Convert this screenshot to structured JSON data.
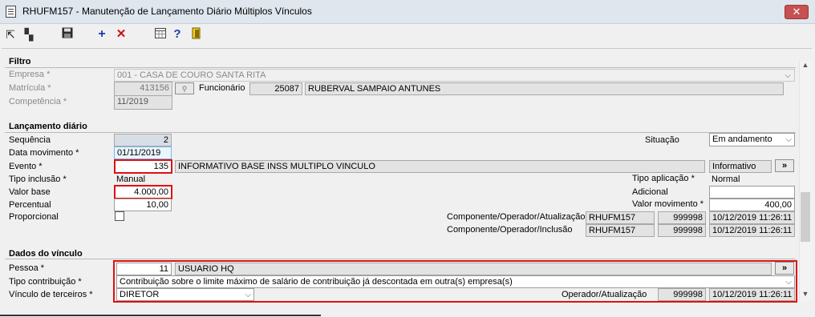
{
  "window": {
    "title": "RHUFM157 - Manutenção de Lançamento Diário Múltiplos Vínculos"
  },
  "filtro": {
    "title": "Filtro",
    "empresa_label": "Empresa *",
    "empresa_value": "001 - CASA DE COURO SANTA RITA",
    "matricula_label": "Matrícula *",
    "matricula_value": "413156",
    "funcionario_label": "Funcionário",
    "funcionario_code": "25087",
    "funcionario_name": "RUBERVAL SAMPAIO ANTUNES",
    "competencia_label": "Competência *",
    "competencia_value": "11/2019"
  },
  "lancamento": {
    "title": "Lançamento diário",
    "sequencia_label": "Sequência",
    "sequencia_value": "2",
    "situacao_label": "Situação",
    "situacao_value": "Em andamento",
    "data_label": "Data movimento *",
    "data_value": "01/11/2019",
    "evento_label": "Evento *",
    "evento_code": "135",
    "evento_desc": "INFORMATIVO BASE INSS MULTIPLO VINCULO",
    "evento_tipo": "Informativo",
    "evento_btn": "»",
    "tipo_inclusao_label": "Tipo inclusão *",
    "tipo_inclusao_value": "Manual",
    "tipo_aplicacao_label": "Tipo aplicação *",
    "tipo_aplicacao_value": "Normal",
    "valor_base_label": "Valor base",
    "valor_base_value": "4.000,00",
    "adicional_label": "Adicional",
    "adicional_value": "",
    "percentual_label": "Percentual",
    "percentual_value": "10,00",
    "valor_mov_label": "Valor movimento *",
    "valor_mov_value": "400,00",
    "proporcional_label": "Proporcional",
    "comp_atual_label": "Componente/Operador/Atualização",
    "comp_atual_comp": "RHUFM157",
    "comp_atual_op": "999998",
    "comp_atual_dt": "10/12/2019 11:26:11",
    "comp_incl_label": "Componente/Operador/Inclusão",
    "comp_incl_comp": "RHUFM157",
    "comp_incl_op": "999998",
    "comp_incl_dt": "10/12/2019 11:26:11"
  },
  "vinculo": {
    "title": "Dados do vínculo",
    "pessoa_label": "Pessoa *",
    "pessoa_code": "11",
    "pessoa_name": "USUARIO HQ",
    "pessoa_btn": "»",
    "tipo_contrib_label": "Tipo contribuição *",
    "tipo_contrib_value": "Contribuição sobre o limite máximo de salário de contribuição já descontada em outra(s) empresa(s)",
    "vinculo_terc_label": "Vínculo de terceiros *",
    "vinculo_terc_value": "DIRETOR",
    "op_atual_label": "Operador/Atualização",
    "op_atual_op": "999998",
    "op_atual_dt": "10/12/2019 11:26:11"
  },
  "icons": [
    "first-record-icon",
    "last-record-icon",
    "save-icon",
    "add-icon",
    "delete-icon",
    "calendar-grid-icon",
    "help-icon",
    "exit-door-icon",
    "close-icon",
    "chevron-down-icon"
  ]
}
